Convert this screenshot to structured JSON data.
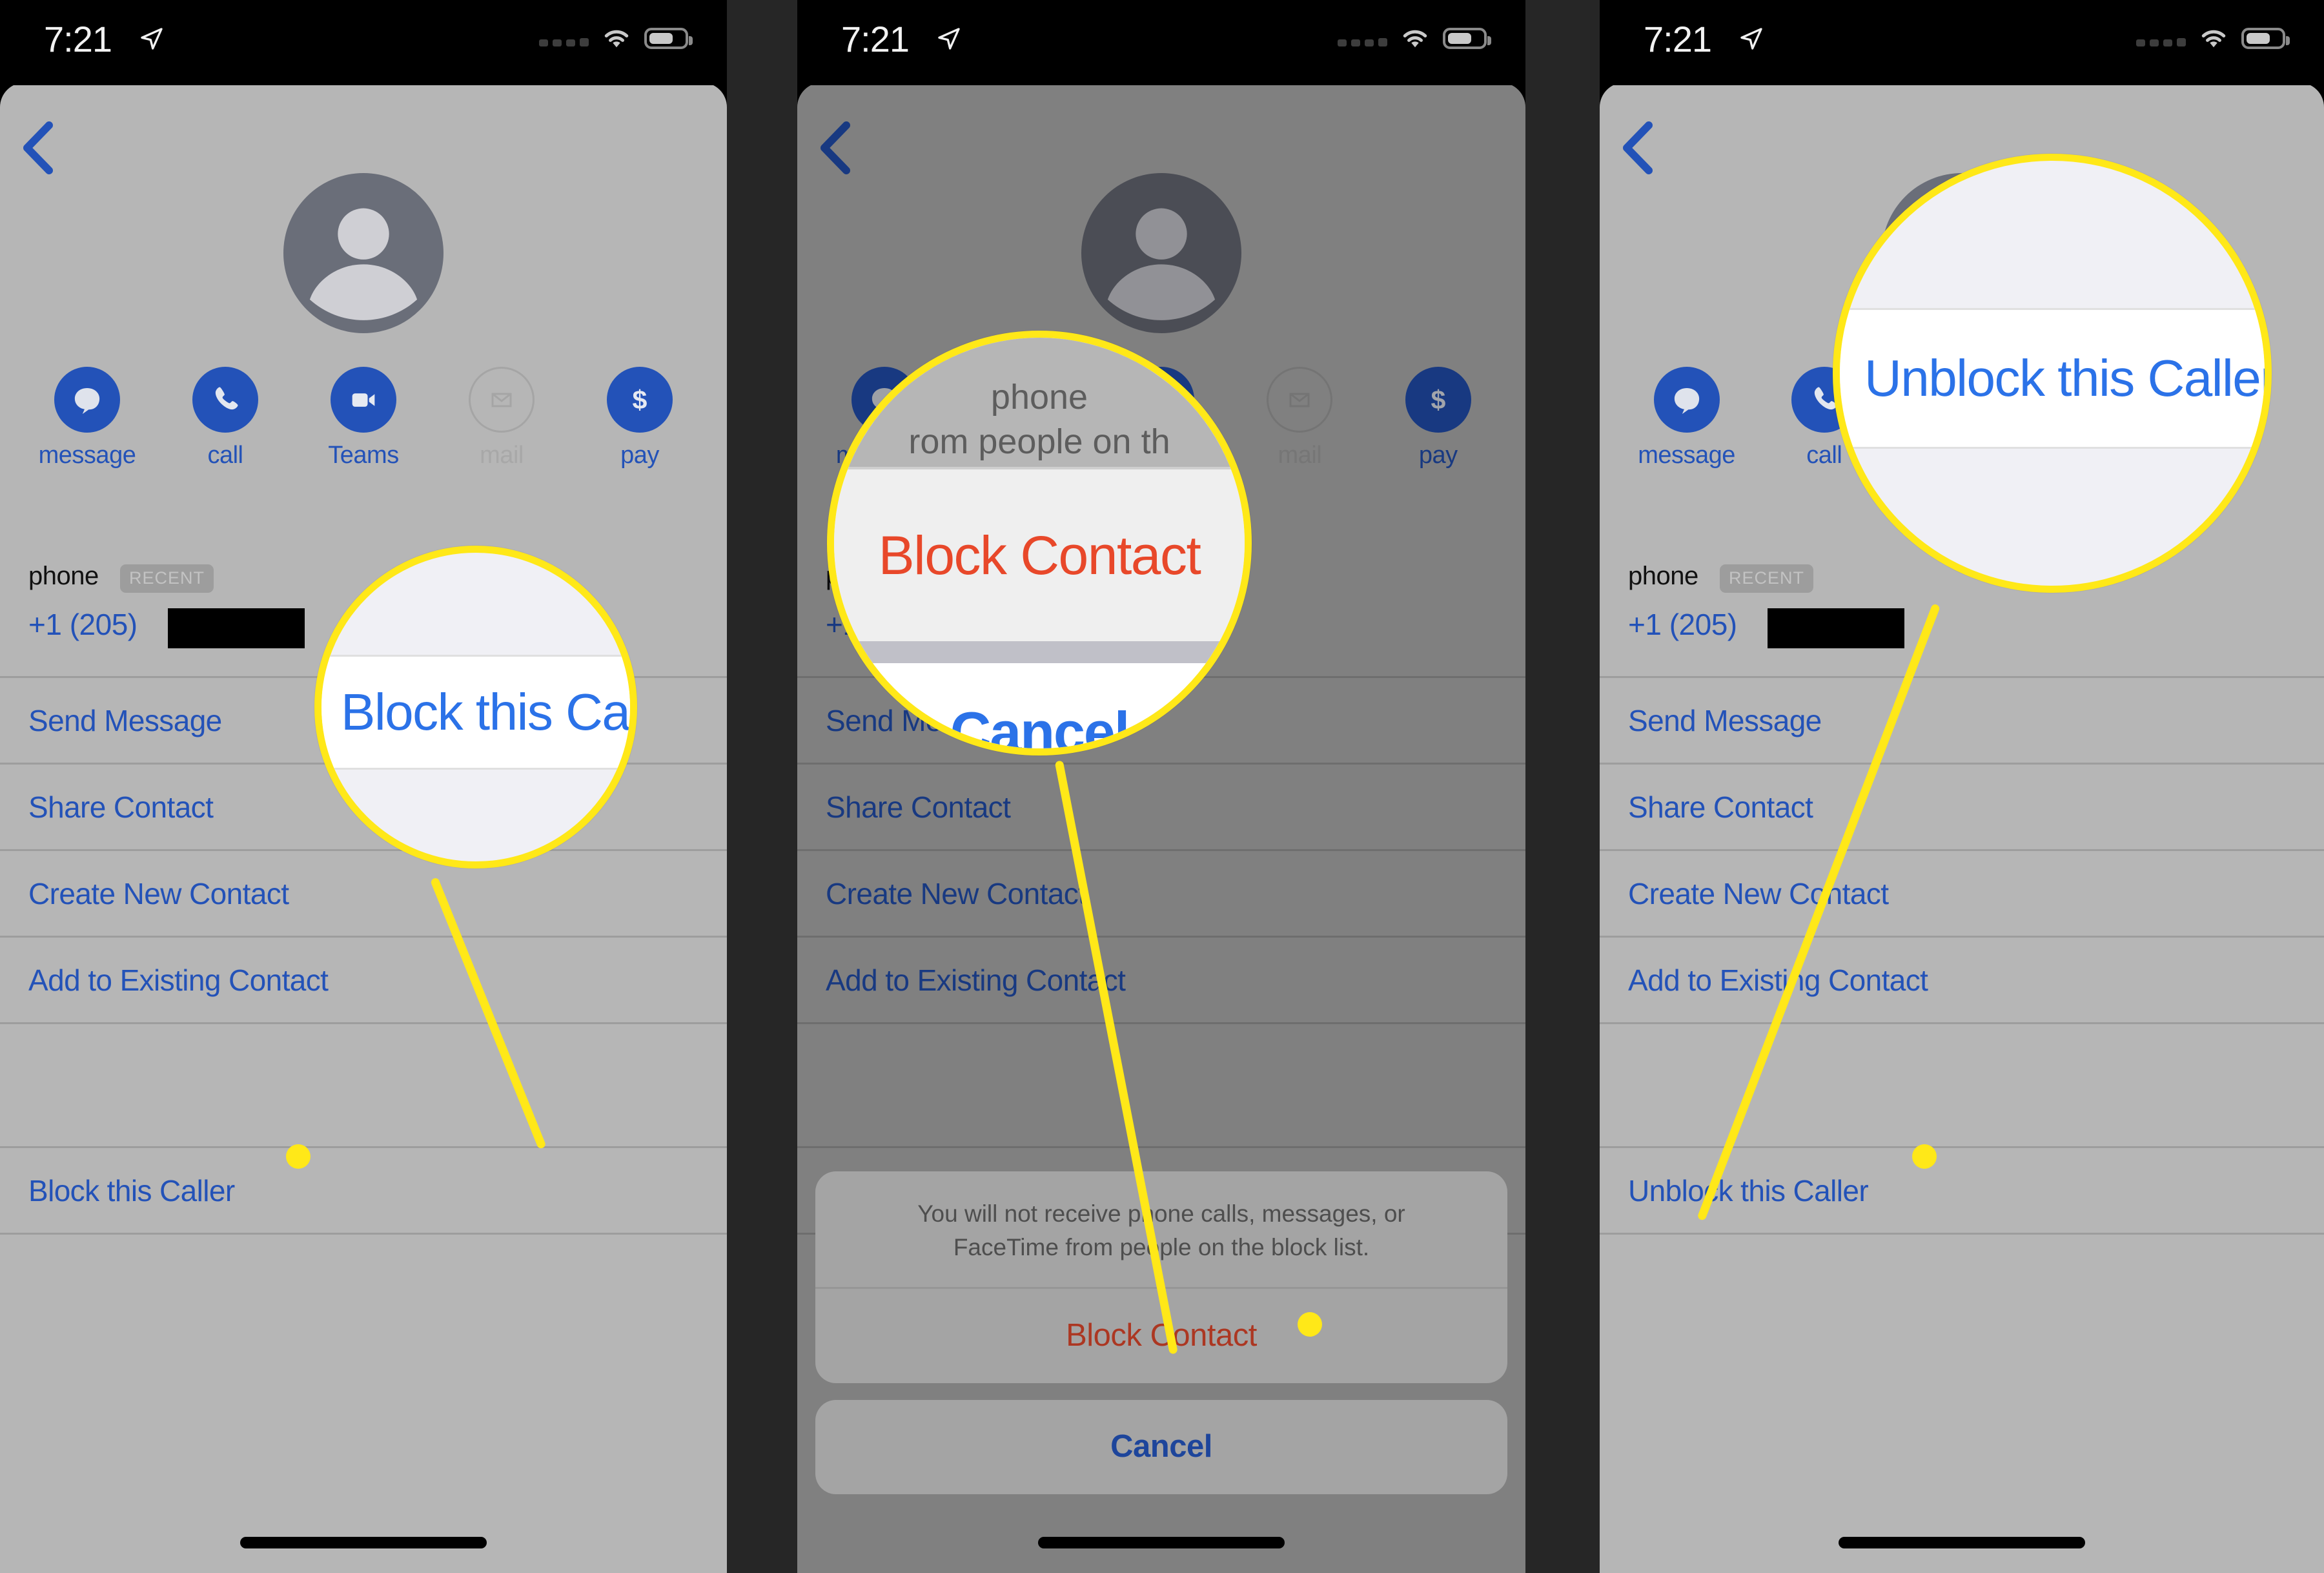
{
  "status_bar": {
    "time": "7:21",
    "location_icon": "location-arrow-icon",
    "signal_icon": "cellular-signal-icon",
    "wifi_icon": "wifi-icon",
    "battery_icon": "battery-icon"
  },
  "nav": {
    "back_icon": "chevron-left-icon"
  },
  "contact": {
    "avatar_icon": "person-placeholder-avatar",
    "actions": [
      {
        "label": "message",
        "icon": "message-bubble-icon",
        "enabled": true
      },
      {
        "label": "call",
        "icon": "phone-handset-icon",
        "enabled": true
      },
      {
        "label": "Teams",
        "icon": "video-camera-icon",
        "enabled": true
      },
      {
        "label": "mail",
        "icon": "envelope-icon",
        "enabled": false
      },
      {
        "label": "pay",
        "icon": "dollar-sign-icon",
        "enabled": true
      }
    ],
    "phone_label": "phone",
    "recent_badge": "RECENT",
    "phone_number": "+1 (205)",
    "phone_number_redacted": true
  },
  "list_rows": {
    "send_message": "Send Message",
    "share_contact": "Share Contact",
    "create_new_contact": "Create New Contact",
    "add_to_existing_contact": "Add to Existing Contact",
    "block_this_caller": "Block this Caller",
    "unblock_this_caller": "Unblock this Caller"
  },
  "action_sheet": {
    "message": "You will not receive phone calls, messages, or FaceTime from people on the block list.",
    "block_contact": "Block Contact",
    "cancel": "Cancel"
  },
  "callouts": {
    "one": {
      "text": "Block this Caller",
      "target": "block-this-caller-row"
    },
    "two": {
      "text": "Block Contact",
      "partial_top_line_a": "phone",
      "partial_top_line_b": "rom people on th",
      "partial_cancel": "Cancel",
      "target": "block-contact-sheet-button"
    },
    "three": {
      "text": "Unblock this Caller",
      "target": "unblock-this-caller-row"
    }
  },
  "colors": {
    "accent_blue": "#2352b8",
    "destructive_red": "#cd4228",
    "highlight_yellow": "#ffe818",
    "card_gray": "#b6b6b6"
  }
}
